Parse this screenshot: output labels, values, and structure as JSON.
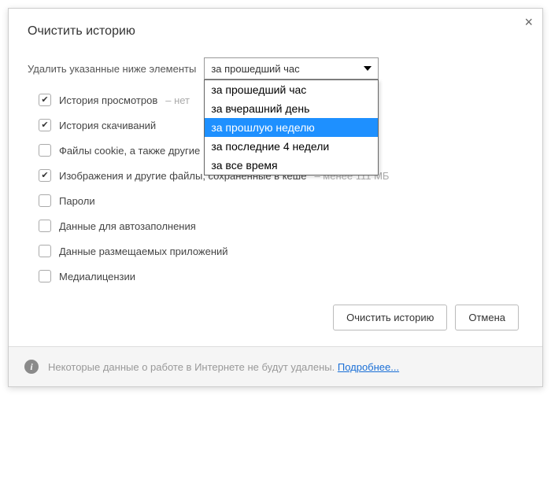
{
  "dialog": {
    "title": "Очистить историю",
    "close": "×",
    "period_label": "Удалить указанные ниже элементы",
    "select": {
      "value": "за прошедший час",
      "options": [
        "за прошедший час",
        "за вчерашний день",
        "за прошлую неделю",
        "за последние 4 недели",
        "за все время"
      ],
      "highlighted_index": 2
    },
    "items": [
      {
        "label": "История просмотров",
        "checked": true,
        "hint": "– нет"
      },
      {
        "label": "История скачиваний",
        "checked": true,
        "hint": ""
      },
      {
        "label": "Файлы cookie, а также другие ",
        "checked": false,
        "hint": ""
      },
      {
        "label": "Изображения и другие файлы, сохраненные в кеше",
        "checked": true,
        "hint": "– менее 111 МБ"
      },
      {
        "label": "Пароли",
        "checked": false,
        "hint": ""
      },
      {
        "label": "Данные для автозаполнения",
        "checked": false,
        "hint": ""
      },
      {
        "label": "Данные размещаемых приложений",
        "checked": false,
        "hint": ""
      },
      {
        "label": "Медиалицензии",
        "checked": false,
        "hint": ""
      }
    ],
    "buttons": {
      "primary": "Очистить историю",
      "cancel": "Отмена"
    },
    "info": {
      "text": "Некоторые данные о работе в Интернете не будут удалены. ",
      "link": "Подробнее..."
    }
  }
}
